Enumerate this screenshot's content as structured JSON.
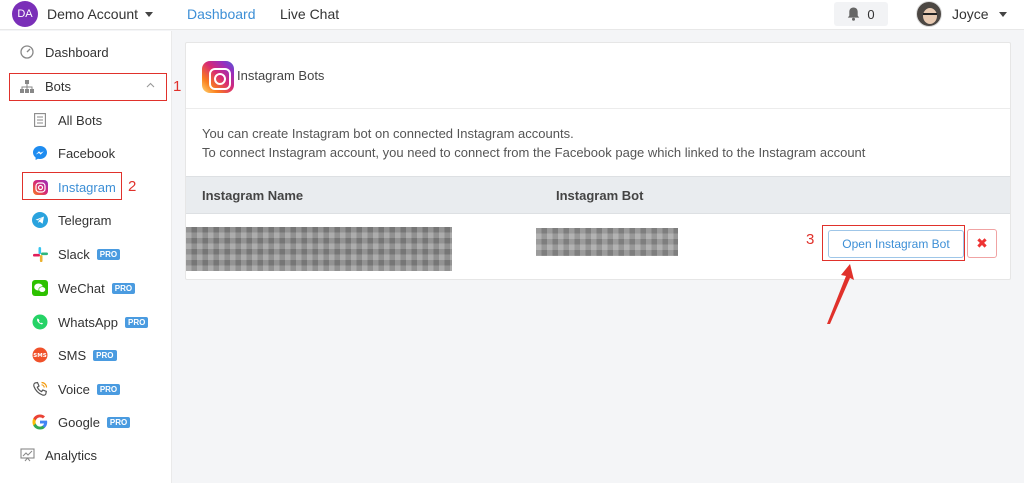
{
  "topbar": {
    "account_initials": "DA",
    "account_name": "Demo Account",
    "nav": [
      {
        "label": "Dashboard",
        "active": true
      },
      {
        "label": "Live Chat",
        "active": false
      }
    ],
    "notifications_count": "0",
    "user_name": "Joyce"
  },
  "sidebar": {
    "items": [
      {
        "label": "Dashboard",
        "icon": "dashboard-icon"
      },
      {
        "label": "Bots",
        "icon": "sitemap-icon",
        "expanded": true
      },
      {
        "label": "All Bots",
        "icon": "list-icon"
      },
      {
        "label": "Facebook",
        "icon": "messenger-icon"
      },
      {
        "label": "Instagram",
        "icon": "instagram-icon",
        "active": true
      },
      {
        "label": "Telegram",
        "icon": "telegram-icon"
      },
      {
        "label": "Slack",
        "icon": "slack-icon",
        "badge": "PRO"
      },
      {
        "label": "WeChat",
        "icon": "wechat-icon",
        "badge": "PRO"
      },
      {
        "label": "WhatsApp",
        "icon": "whatsapp-icon",
        "badge": "PRO"
      },
      {
        "label": "SMS",
        "icon": "sms-icon",
        "badge": "PRO"
      },
      {
        "label": "Voice",
        "icon": "phone-icon",
        "badge": "PRO"
      },
      {
        "label": "Google",
        "icon": "google-icon",
        "badge": "PRO"
      },
      {
        "label": "Analytics",
        "icon": "analytics-icon"
      }
    ]
  },
  "annotations": [
    "1",
    "2",
    "3"
  ],
  "main": {
    "title": "Instagram Bots",
    "description": [
      "You can create Instagram bot on connected Instagram accounts.",
      "To connect Instagram account, you need to connect from the Facebook page which linked to the Instagram account"
    ],
    "table": {
      "columns": [
        "Instagram Name",
        "Instagram Bot"
      ],
      "rows": [
        {
          "open_label": "Open Instagram Bot",
          "delete_label": "✖"
        }
      ]
    }
  },
  "colors": {
    "accent": "#3d8fd6",
    "annotation_red": "#e0312b",
    "pro_badge": "#4a9be0"
  }
}
